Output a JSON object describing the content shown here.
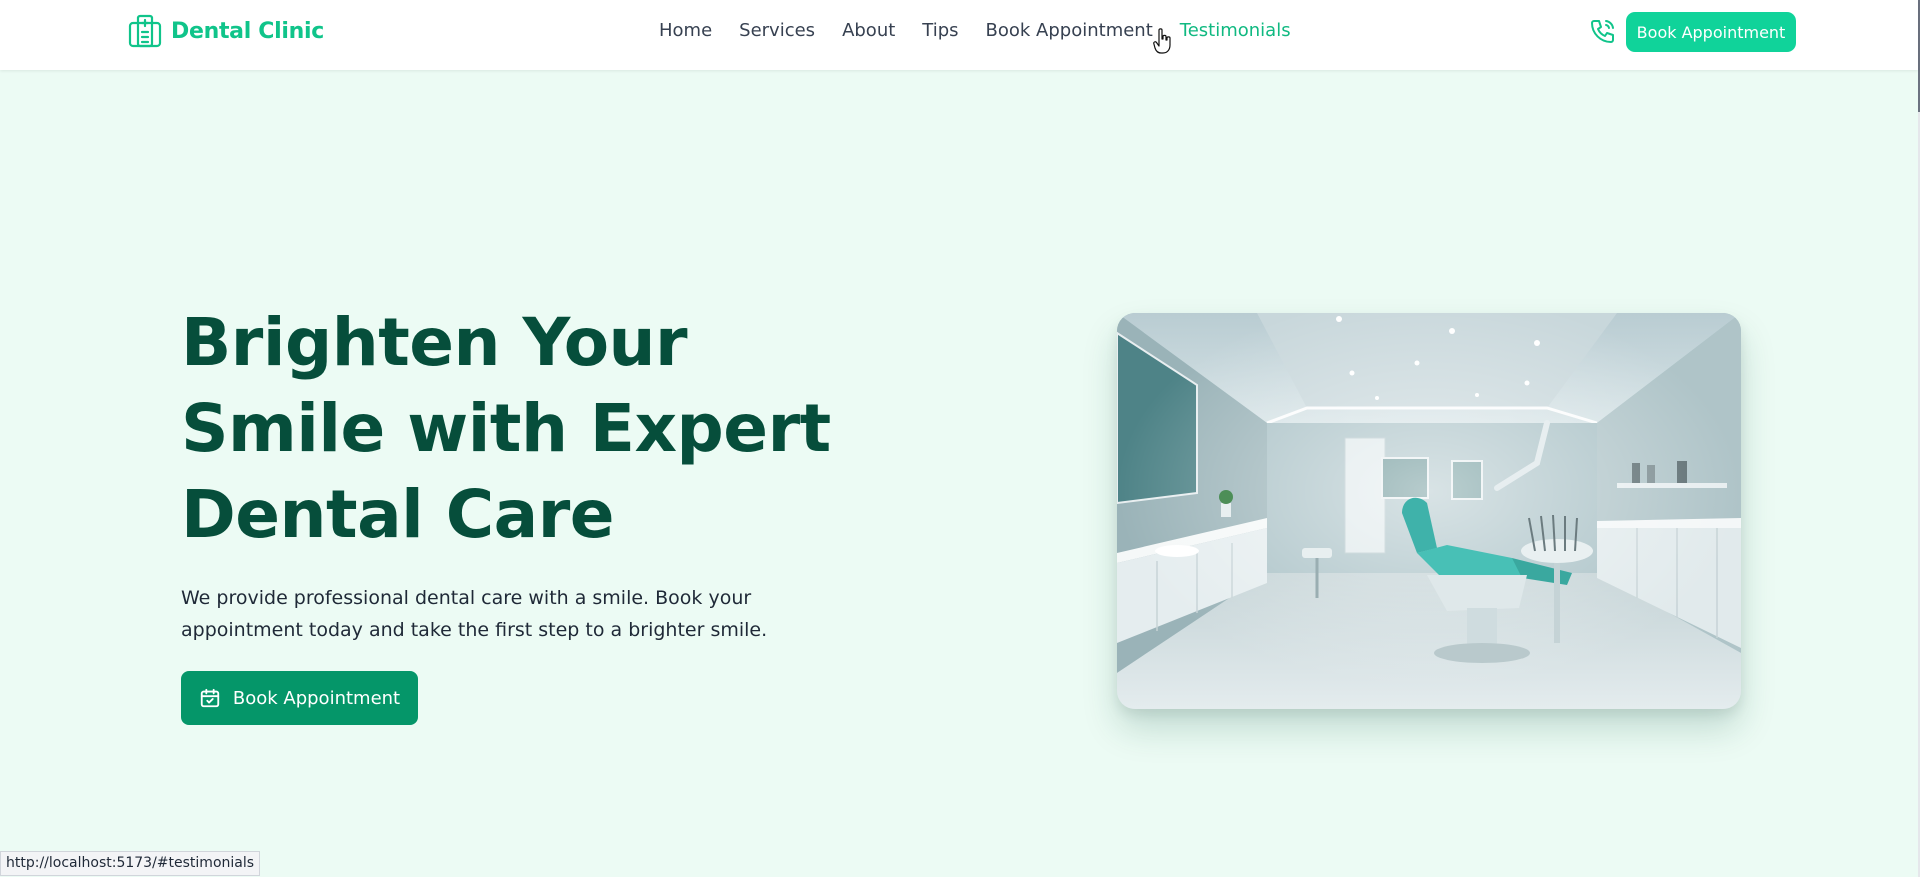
{
  "brand": {
    "name": "Dental Clinic",
    "color": "#10c48a",
    "icon": "hospital-building-icon"
  },
  "nav": {
    "items": [
      {
        "label": "Home"
      },
      {
        "label": "Services"
      },
      {
        "label": "About"
      },
      {
        "label": "Tips"
      },
      {
        "label": "Book Appointment"
      },
      {
        "label": "Testimonials",
        "state": "hovered"
      }
    ]
  },
  "header": {
    "phone_icon": "phone-icon",
    "cta_label": "Book Appointment"
  },
  "hero": {
    "title": "Brighten Your Smile with Expert Dental Care",
    "subtitle": "We provide professional dental care with a smile. Book your appointment today and take the first step to a brighter smile.",
    "cta_label": "Book Appointment",
    "cta_icon": "calendar-check-icon",
    "image_alt": "Modern dental clinic treatment room with teal dental chair"
  },
  "status_bar": {
    "url": "http://localhost:5173/#testimonials"
  },
  "colors": {
    "accent": "#10d39a",
    "primary_dark": "#064e3b",
    "button_dark": "#059669",
    "background": "#ecfbf4"
  }
}
